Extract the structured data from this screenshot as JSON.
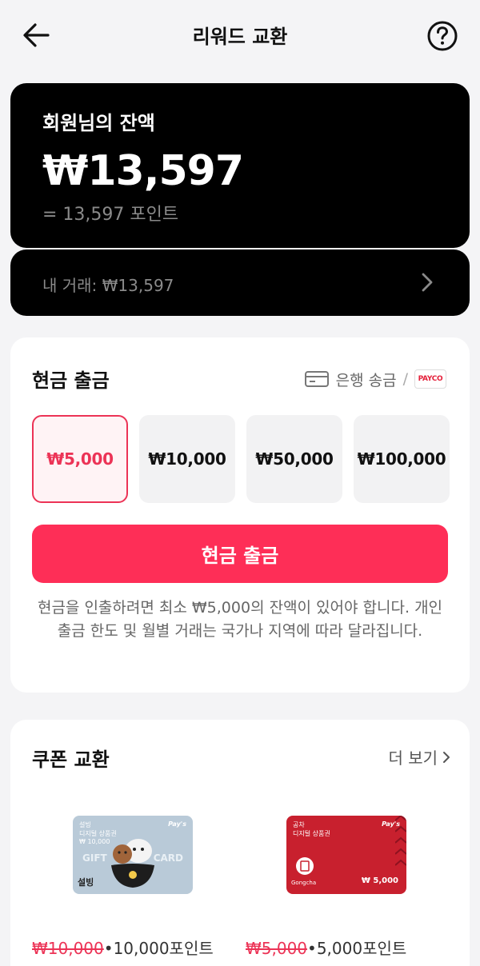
{
  "header": {
    "title": "리워드 교환",
    "back_icon": "arrow-left-icon",
    "help_icon": "question-circle-icon"
  },
  "balance": {
    "label": "회원님의 잔액",
    "amount": "₩13,597",
    "points": "= 13,597 포인트"
  },
  "transactions": {
    "label": "내 거래: ₩13,597"
  },
  "cash_out": {
    "title": "현금 출금",
    "bank_label": "은행 송금",
    "separator": "/",
    "payco_label": "PAYCO",
    "amounts": [
      "₩5,000",
      "₩10,000",
      "₩50,000",
      "₩100,000"
    ],
    "selected_index": 0,
    "button_label": "현금 출금",
    "notice": "현금을 인출하려면 최소 ₩5,000의 잔액이 있어야 합니다. 개인 출금 한도 및 월별 거래는 국가나 지역에 따라 달라집니다."
  },
  "coupons": {
    "title": "쿠폰 교환",
    "more_label": "더 보기",
    "items": [
      {
        "card_top": "설빙",
        "card_sub": "디지털 상품권",
        "card_value": "₩ 10,000",
        "card_word_left": "GIFT",
        "card_word_right": "CARD",
        "card_logo": "설빙",
        "brand_tag": "Pay's",
        "old_price": "₩10,000",
        "dot": "•",
        "points": "10,000포인트"
      },
      {
        "card_top": "공차",
        "card_sub": "디지털 상품권",
        "card_value": "₩ 5,000",
        "card_logo": "Gongcha",
        "brand_tag": "Pay's",
        "old_price": "₩5,000",
        "dot": "•",
        "points": "5,000포인트"
      }
    ]
  },
  "colors": {
    "accent": "#fe2e57",
    "selected_border": "#ec3356",
    "card_black": "#000000",
    "muted_text": "#8a8a8a",
    "gongcha_red": "#c8202e"
  }
}
